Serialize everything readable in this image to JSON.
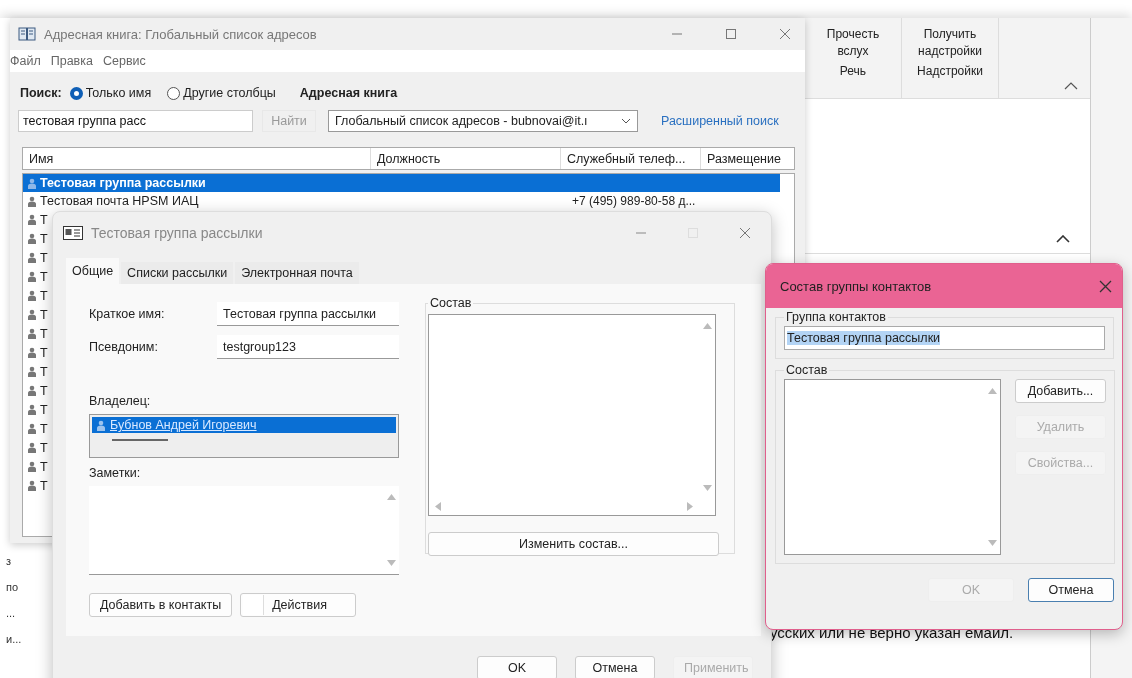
{
  "ribbon": {
    "groups": [
      {
        "button": "Прочесть вслух",
        "label": "Речь"
      },
      {
        "button": "Получить надстройки",
        "label": "Надстройки"
      }
    ]
  },
  "background_fragments": [
    "з",
    "по",
    "...",
    "и..."
  ],
  "document_text": "усских или не верно указан емаил.",
  "address_book": {
    "title": "Адресная книга: Глобальный список адресов",
    "menu": [
      "Файл",
      "Правка",
      "Сервис"
    ],
    "search_label": "Поиск:",
    "search_modes": [
      {
        "label": "Только имя",
        "selected": true
      },
      {
        "label": "Другие столбцы",
        "selected": false
      }
    ],
    "book_label": "Адресная книга",
    "search_field": {
      "value": "тестовая группа расс"
    },
    "find_button": {
      "label": "Найти",
      "disabled": true
    },
    "book_dropdown": {
      "value": "Глобальный список адресов - bubnovai@it.ı"
    },
    "advanced_link": "Расширенный поиск",
    "columns": [
      "Имя",
      "Должность",
      "Служебный телеф...",
      "Размещение"
    ],
    "rows": [
      {
        "name": "Тестовая группа рассылки",
        "selected": true
      },
      {
        "name": "Тестовая почта HPSM ИАЦ",
        "phone": "+7 (495) 989-80-58 д...",
        "selected": false
      },
      {
        "name": "Т",
        "selected": false
      },
      {
        "name": "Т",
        "selected": false
      },
      {
        "name": "Т",
        "selected": false
      },
      {
        "name": "Т",
        "selected": false
      },
      {
        "name": "Т",
        "selected": false
      },
      {
        "name": "Т",
        "selected": false
      },
      {
        "name": "Т",
        "selected": false
      },
      {
        "name": "Т",
        "selected": false
      },
      {
        "name": "Т",
        "selected": false
      },
      {
        "name": "Т",
        "selected": false
      },
      {
        "name": "Т",
        "selected": false
      },
      {
        "name": "Т",
        "selected": false
      },
      {
        "name": "Т",
        "selected": false
      },
      {
        "name": "Т",
        "selected": false
      },
      {
        "name": "Т",
        "selected": false
      }
    ]
  },
  "properties": {
    "title": "Тестовая группа рассылки",
    "tabs": [
      {
        "label": "Общие",
        "selected": true
      },
      {
        "label": "Списки рассылки",
        "selected": false
      },
      {
        "label": "Электронная почта",
        "selected": false
      }
    ],
    "fields": [
      {
        "label": "Краткое имя:",
        "value": "Тестовая группа рассылки"
      },
      {
        "label": "Псевдоним:",
        "value": "testgroup123"
      }
    ],
    "owner_label": "Владелец:",
    "owners": [
      {
        "name": "Бубнов Андрей Игоревич",
        "selected": true
      }
    ],
    "notes_label": "Заметки:",
    "members_label": "Состав",
    "edit_members_button": "Изменить состав...",
    "add_contacts_button": "Добавить в контакты",
    "actions_button": "Действия",
    "buttons": [
      {
        "label": "OK",
        "disabled": false
      },
      {
        "label": "Отмена",
        "disabled": false
      },
      {
        "label": "Применить",
        "disabled": true
      }
    ]
  },
  "group_dialog": {
    "title": "Состав группы контактов",
    "group_label": "Группа контактов",
    "group_name": {
      "value": "Тестовая группа рассылки",
      "selected": true
    },
    "members_label": "Состав",
    "side_buttons": [
      {
        "label": "Добавить...",
        "disabled": false
      },
      {
        "label": "Удалить",
        "disabled": true
      },
      {
        "label": "Свойства...",
        "disabled": true
      }
    ],
    "buttons": [
      {
        "label": "OK",
        "disabled": true
      },
      {
        "label": "Отмена",
        "disabled": false
      }
    ]
  }
}
